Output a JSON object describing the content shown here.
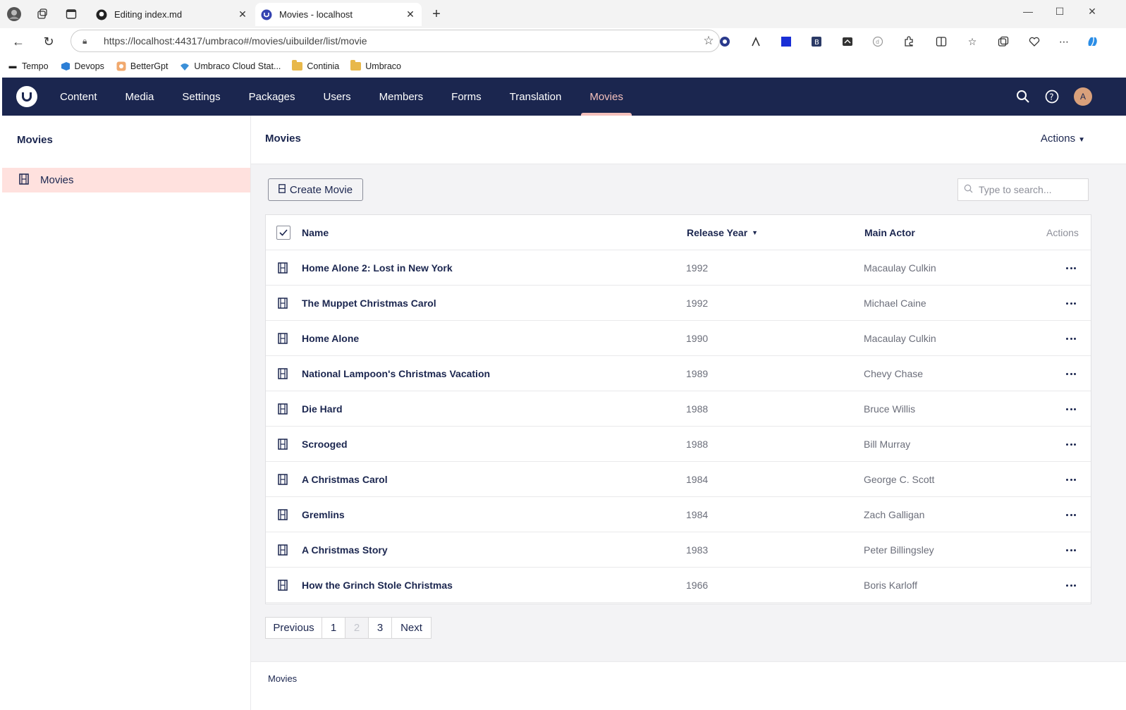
{
  "browser": {
    "tabs": [
      {
        "title": "Editing index.md"
      },
      {
        "title": "Movies - localhost"
      }
    ],
    "url": "https://localhost:44317/umbraco#/movies/uibuilder/list/movie",
    "bookmarks": [
      {
        "label": "Tempo"
      },
      {
        "label": "Devops"
      },
      {
        "label": "BetterGpt"
      },
      {
        "label": "Umbraco Cloud Stat..."
      },
      {
        "label": "Continia"
      },
      {
        "label": "Umbraco"
      }
    ]
  },
  "header": {
    "sections": [
      "Content",
      "Media",
      "Settings",
      "Packages",
      "Users",
      "Members",
      "Forms",
      "Translation",
      "Movies"
    ],
    "active_section": "Movies",
    "avatar_initial": "A",
    "colors": {
      "header_bg": "#1b264f",
      "active": "#f5c1bc"
    }
  },
  "tree": {
    "title": "Movies",
    "items": [
      {
        "label": "Movies"
      }
    ]
  },
  "main": {
    "title": "Movies",
    "actions_label": "Actions",
    "create_label": "Create Movie",
    "search_placeholder": "Type to search...",
    "columns": {
      "name": "Name",
      "year": "Release Year",
      "actor": "Main Actor",
      "actions": "Actions"
    },
    "rows": [
      {
        "name": "Home Alone 2: Lost in New York",
        "year": "1992",
        "actor": "Macaulay Culkin"
      },
      {
        "name": "The Muppet Christmas Carol",
        "year": "1992",
        "actor": "Michael Caine"
      },
      {
        "name": "Home Alone",
        "year": "1990",
        "actor": "Macaulay Culkin"
      },
      {
        "name": "National Lampoon's Christmas Vacation",
        "year": "1989",
        "actor": "Chevy Chase"
      },
      {
        "name": "Die Hard",
        "year": "1988",
        "actor": "Bruce Willis"
      },
      {
        "name": "Scrooged",
        "year": "1988",
        "actor": "Bill Murray"
      },
      {
        "name": "A Christmas Carol",
        "year": "1984",
        "actor": "George C. Scott"
      },
      {
        "name": "Gremlins",
        "year": "1984",
        "actor": "Zach Galligan"
      },
      {
        "name": "A Christmas Story",
        "year": "1983",
        "actor": "Peter Billingsley"
      },
      {
        "name": "How the Grinch Stole Christmas",
        "year": "1966",
        "actor": "Boris Karloff"
      }
    ],
    "pagination": {
      "previous": "Previous",
      "pages": [
        "1",
        "2",
        "3"
      ],
      "current": "2",
      "next": "Next"
    },
    "footer_breadcrumb": "Movies"
  }
}
